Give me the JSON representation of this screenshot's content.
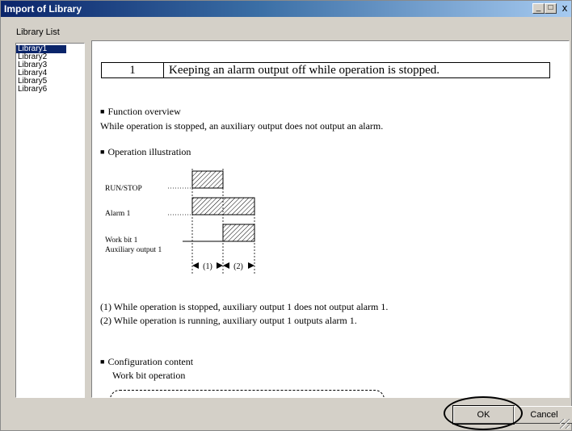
{
  "window": {
    "title": "Import of Library",
    "controls": {
      "minimize": "_",
      "maximize": "□",
      "close": "x"
    }
  },
  "library_list": {
    "caption": "Library List",
    "items": [
      "Library1",
      "Library2",
      "Library3",
      "Library4",
      "Library5",
      "Library6"
    ],
    "selected": "Library1"
  },
  "document": {
    "number": "1",
    "title": "Keeping an alarm output off while operation is stopped.",
    "function_overview_heading": "Function overview",
    "function_overview_text": "While operation is stopped, an auxiliary output does not output an alarm.",
    "operation_illustration_heading": "Operation illustration",
    "diagram": {
      "run_stop_label": "RUN/STOP",
      "alarm_label": "Alarm 1",
      "work_bit_label": "Work bit 1",
      "aux_output_label": "Auxiliary output 1",
      "interval1_label": "(1)",
      "interval2_label": "(2)"
    },
    "note1": "(1) While operation is stopped, auxiliary output 1 does not output alarm 1.",
    "note2": "(2) While operation is running, auxiliary output 1 outputs alarm 1.",
    "configuration_heading": "Configuration content",
    "configuration_sub": "Work bit operation"
  },
  "buttons": {
    "ok": "OK",
    "cancel": "Cancel"
  },
  "colors": {
    "title_bar_start": "#0a246a",
    "selection": "#0a246a",
    "dialog_face": "#d4d0c8"
  }
}
